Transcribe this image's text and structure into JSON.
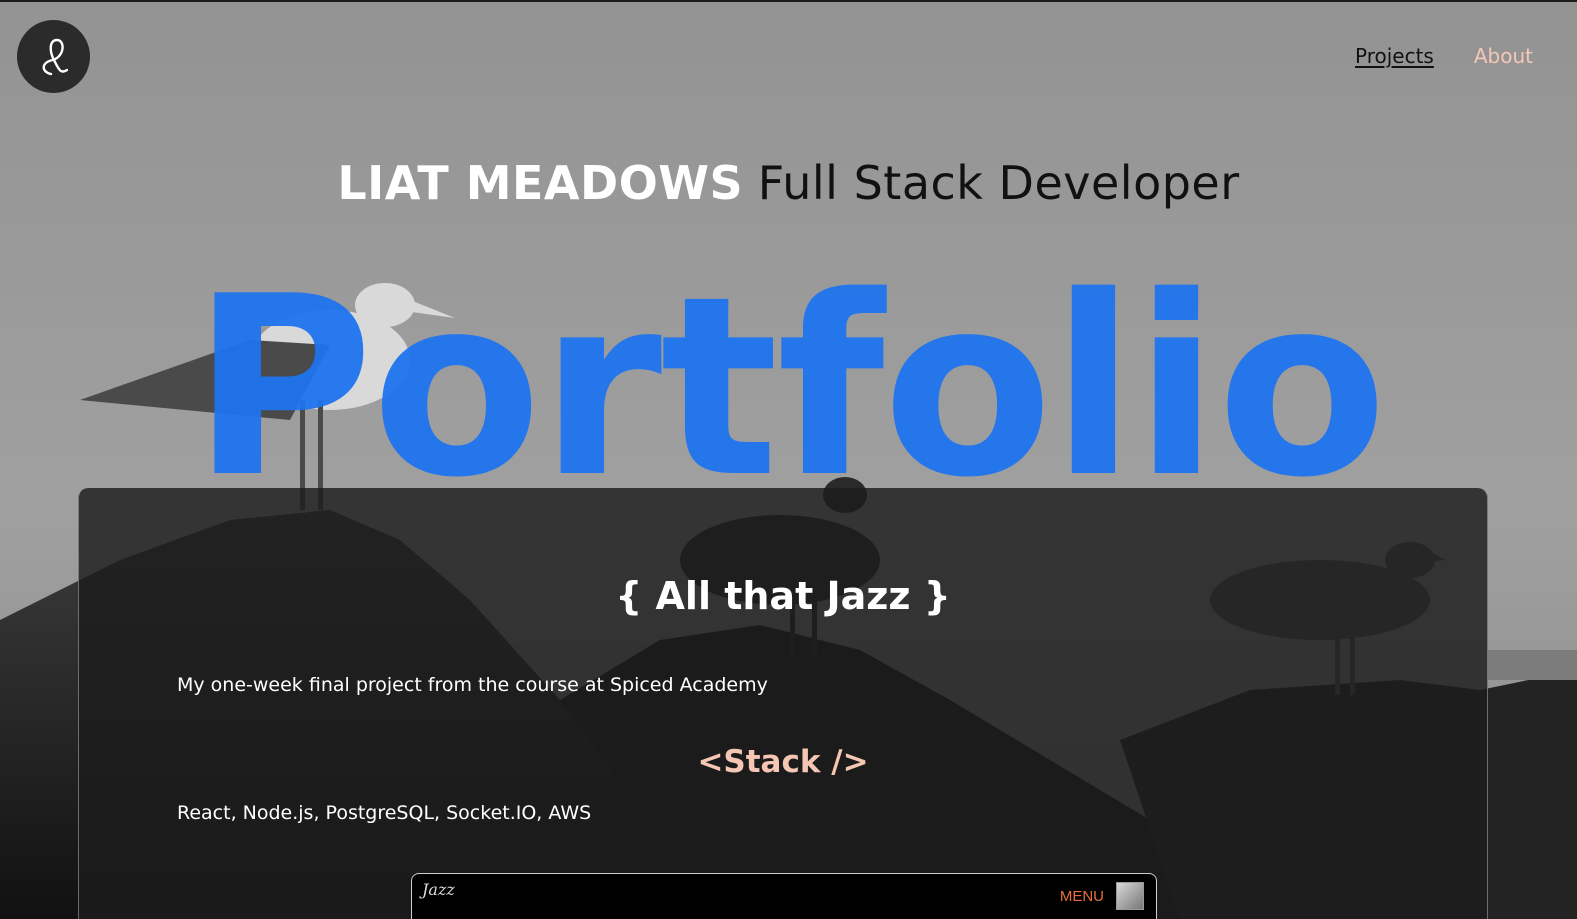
{
  "header": {
    "nav": [
      {
        "label": "Projects"
      },
      {
        "label": "About"
      }
    ]
  },
  "hero": {
    "name": "LIAT MEADOWS",
    "role": "Full Stack Developer",
    "big_word": "Portfolio"
  },
  "project": {
    "title": "{ All that Jazz }",
    "description": "My one-week final project from the course at Spiced Academy",
    "stack_title": "<Stack />",
    "stack": "React, Node.js, PostgreSQL, Socket.IO, AWS",
    "preview": {
      "logo_text": "Jazz",
      "menu_label": "MENU"
    }
  },
  "colors": {
    "accent_blue": "#1f74f0",
    "accent_peach": "#f4c7b7",
    "card_bg": "#1c1c1c"
  },
  "icons": {
    "logo": "cursive-l-logo-icon"
  }
}
